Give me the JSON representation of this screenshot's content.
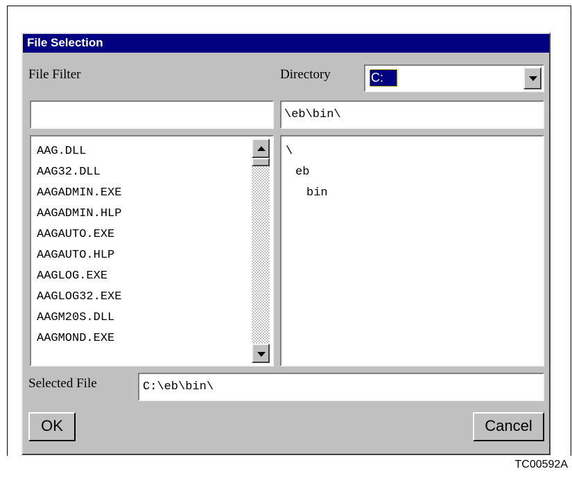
{
  "dialog": {
    "title": "File Selection"
  },
  "file_filter": {
    "label": "File Filter",
    "value": ""
  },
  "directory": {
    "label": "Directory",
    "selected_drive": "C:",
    "path_value": "\\eb\\bin\\"
  },
  "file_list": {
    "items": [
      "AAG.DLL",
      "AAG32.DLL",
      "AAGADMIN.EXE",
      "AAGADMIN.HLP",
      "AAGAUTO.EXE",
      "AAGAUTO.HLP",
      "AAGLOG.EXE",
      "AAGLOG32.EXE",
      "AAGM20S.DLL",
      "AAGMOND.EXE"
    ]
  },
  "directory_tree": {
    "items": [
      "\\",
      "eb",
      "bin"
    ]
  },
  "selected_file": {
    "label": "Selected File",
    "value": "C:\\eb\\bin\\"
  },
  "buttons": {
    "ok": "OK",
    "cancel": "Cancel"
  },
  "figure_code": "TC00592A"
}
